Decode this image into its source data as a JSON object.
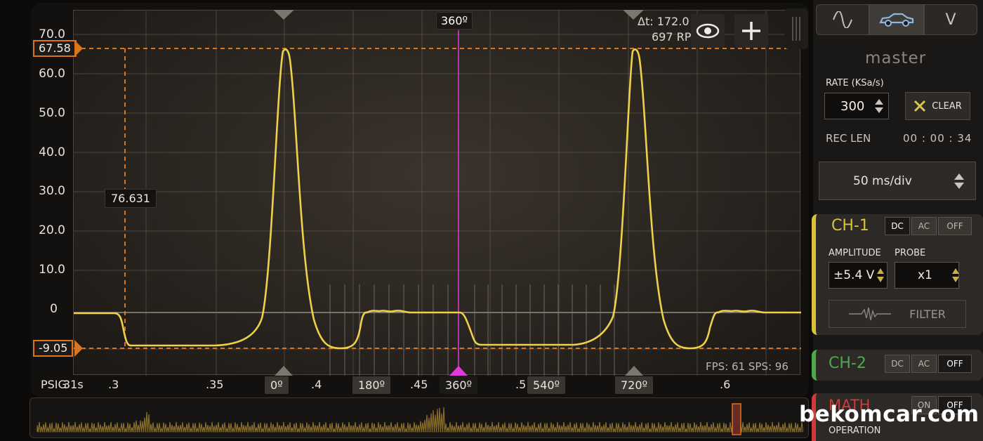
{
  "plot": {
    "y_ticks": [
      "70.0",
      "60.0",
      "50.0",
      "40.0",
      "30.0",
      "20.0",
      "10.0",
      "0"
    ],
    "x_ticks": [
      ".3",
      ".35",
      ".4",
      ".45",
      ".5",
      ".6"
    ],
    "unit_label": "PSIG",
    "time_readout": "31s",
    "level_high": "67.58",
    "level_low": "-9.05",
    "value_marker": "76.631",
    "cursor_angle": "360º",
    "delta_t": "Δt: 172.0",
    "rpm": "697 RP",
    "fps_sps": "FPS: 61  SPS: 96",
    "angle_markers": [
      "0º",
      "180º",
      "360º",
      "540º",
      "720º"
    ]
  },
  "panel": {
    "mode_wave_icon": "sine-wave-icon",
    "mode_car_icon": "car-icon",
    "mode_volt_label": "V",
    "master_label": "master",
    "rate_label": "RATE (KSa/s)",
    "rate_value": "300",
    "clear_label": "CLEAR",
    "rec_len_label": "REC LEN",
    "rec_len_value": "00 : 00 : 34",
    "timebase": "50 ms/div"
  },
  "ch1": {
    "label": "CH-1",
    "modes": [
      "DC",
      "AC",
      "OFF"
    ],
    "amplitude_label": "AMPLITUDE",
    "probe_label": "PROBE",
    "amplitude_value": "±5.4 V",
    "probe_value": "x1",
    "filter_label": "FILTER",
    "color": "#d9c23a"
  },
  "ch2": {
    "label": "CH-2",
    "modes": [
      "DC",
      "AC",
      "OFF"
    ],
    "color": "#4caa4c"
  },
  "math": {
    "label": "MATH",
    "modes": [
      "ON",
      "OFF"
    ],
    "operation_label": "OPERATION",
    "color": "#d03a3a"
  },
  "watermark": "bekomcar.com",
  "colors": {
    "trace": "#efd04a",
    "cursor": "#e23ad8",
    "level": "#d9751f"
  }
}
